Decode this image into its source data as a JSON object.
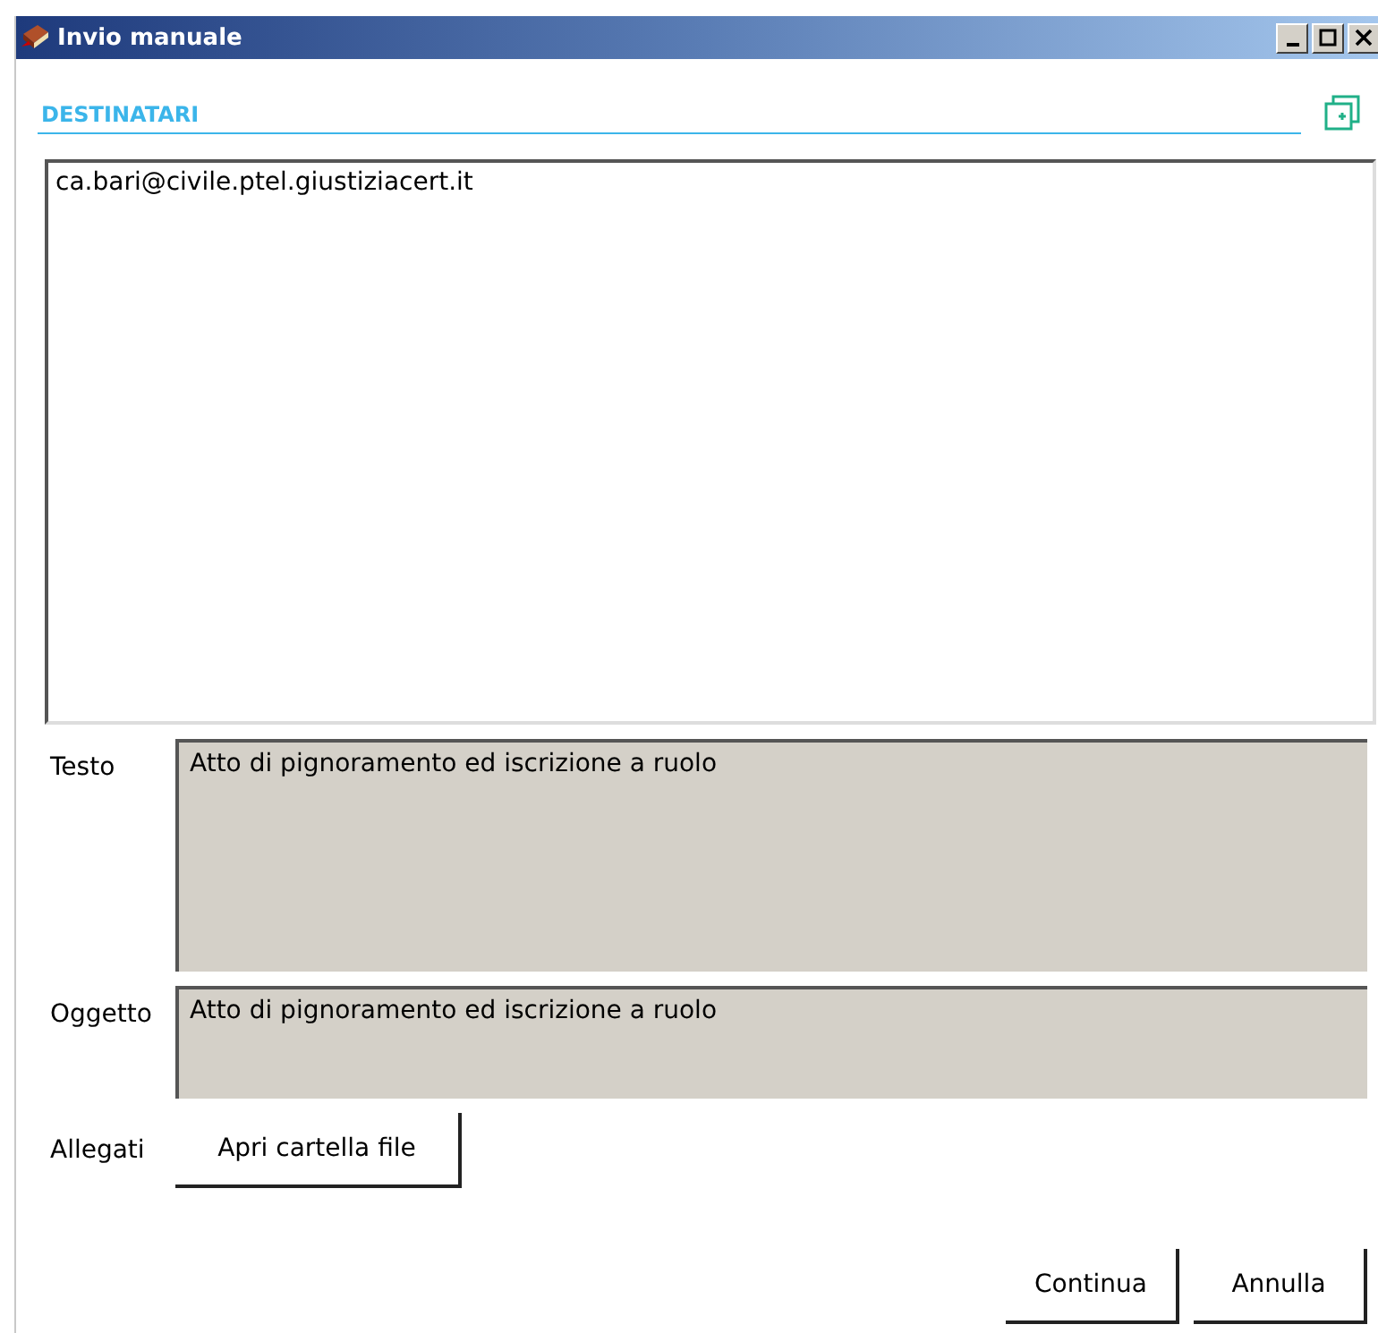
{
  "window": {
    "title": "Invio manuale"
  },
  "recipients": {
    "label": "DESTINATARI",
    "value": "ca.bari@civile.ptel.giustiziacert.it"
  },
  "fields": [
    {
      "label": "Testo",
      "value": "Atto di pignoramento ed iscrizione a ruolo",
      "kind": "multiline"
    },
    {
      "label": "Oggetto",
      "value": "Atto di pignoramento ed iscrizione a ruolo",
      "kind": "single"
    }
  ],
  "attachments": {
    "label": "Allegati",
    "button": "Apri cartella file"
  },
  "buttons": [
    "Continua",
    "Annulla"
  ]
}
